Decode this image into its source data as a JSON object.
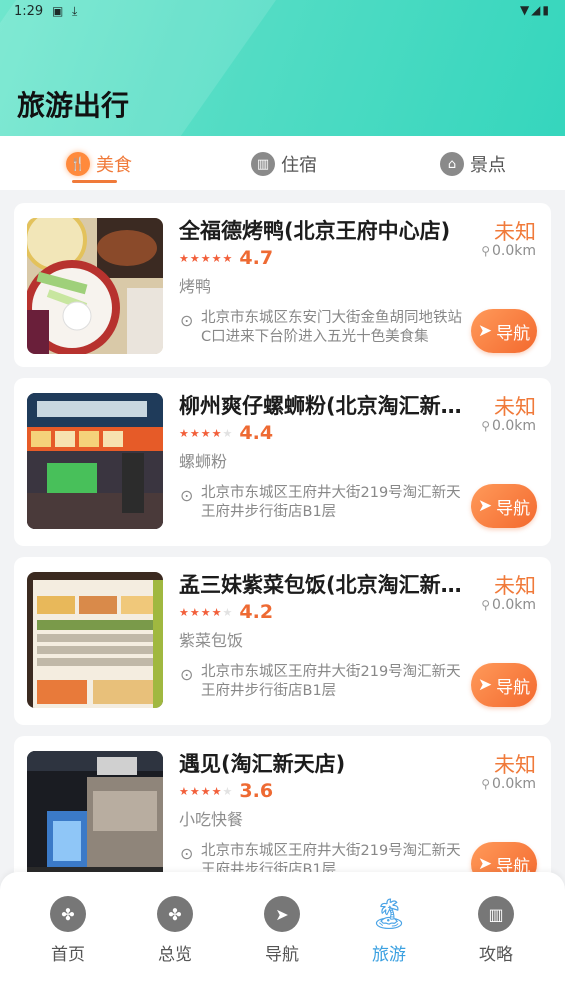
{
  "status_bar": {
    "time": "1:29"
  },
  "header": {
    "title": "旅游出行"
  },
  "tabs": [
    {
      "label": "美食",
      "icon": "food-icon"
    },
    {
      "label": "住宿",
      "icon": "hotel-icon"
    },
    {
      "label": "景点",
      "icon": "scenic-icon"
    }
  ],
  "listings": [
    {
      "name": "全福德烤鸭(北京王府中心店)",
      "rating": "4.7",
      "rating_value": 4.7,
      "category": "烤鸭",
      "status": "未知",
      "distance": "0.0km",
      "address": "北京市东城区东安门大街金鱼胡同地铁站C口进来下台阶进入五光十色美食集",
      "nav_label": "导航"
    },
    {
      "name": "柳州爽仔螺蛳粉(北京淘汇新天店)",
      "rating": "4.4",
      "rating_value": 4.4,
      "category": "螺蛳粉",
      "status": "未知",
      "distance": "0.0km",
      "address": "北京市东城区王府井大街219号淘汇新天王府井步行街店B1层",
      "nav_label": "导航"
    },
    {
      "name": "孟三妹紫菜包饭(北京淘汇新天店)",
      "rating": "4.2",
      "rating_value": 4.2,
      "category": "紫菜包饭",
      "status": "未知",
      "distance": "0.0km",
      "address": "北京市东城区王府井大街219号淘汇新天王府井步行街店B1层",
      "nav_label": "导航"
    },
    {
      "name": "遇见(淘汇新天店)",
      "rating": "3.6",
      "rating_value": 3.6,
      "category": "小吃快餐",
      "status": "未知",
      "distance": "0.0km",
      "address": "北京市东城区王府井大街219号淘汇新天王府井步行街店B1层",
      "nav_label": "导航"
    }
  ],
  "bottom_nav": [
    {
      "label": "首页",
      "icon": "home-icon"
    },
    {
      "label": "总览",
      "icon": "overview-icon"
    },
    {
      "label": "导航",
      "icon": "navigation-icon"
    },
    {
      "label": "旅游",
      "icon": "travel-palm-icon"
    },
    {
      "label": "攻略",
      "icon": "guide-book-icon"
    }
  ],
  "colors": {
    "header_accent": "#3fd8bf",
    "active_tab": "#f07a3a",
    "nav_button": "#f3692e",
    "bottom_active": "#3aa0e0"
  }
}
